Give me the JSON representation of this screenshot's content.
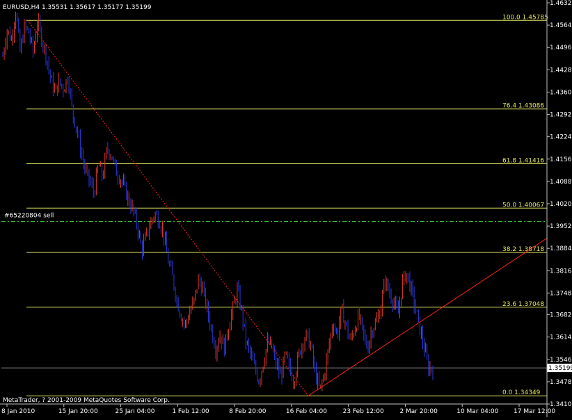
{
  "header": {
    "symbol_text": "EURUSD,H4  1.35531 1.35617 1.35177 1.35199"
  },
  "footer": {
    "copyright": "MetaTrader, ? 2001-2009 MetaQuotes Software Corp."
  },
  "colors": {
    "background": "#000000",
    "axis": "#c0c0c0",
    "text": "#ffffff",
    "fibo": "#e8e860",
    "bull_candle": "#e03a2a",
    "bear_candle": "#2a3ae0",
    "trendline": "#ff2020",
    "order_line": "#30c030",
    "bid_line": "#808080",
    "bid_box_bg": "#ffffff",
    "bid_box_text": "#000000"
  },
  "chart_data": {
    "type": "candlestick",
    "symbol": "EURUSD",
    "timeframe": "H4",
    "ohlc": {
      "open": 1.35531,
      "high": 1.35617,
      "low": 1.35177,
      "close": 1.35199
    },
    "ylim": [
      1.341,
      1.4632
    ],
    "y_ticks": [
      "1.46320",
      "1.45640",
      "1.44960",
      "1.44280",
      "1.43600",
      "1.42920",
      "1.42240",
      "1.41560",
      "1.40880",
      "1.40200",
      "1.39520",
      "1.38840",
      "1.38160",
      "1.37480",
      "1.36820",
      "1.36140",
      "1.35460",
      "1.34780",
      "1.34100"
    ],
    "x_ticks": [
      "8 Jan 2010",
      "15 Jan 20:00",
      "25 Jan 04:00",
      "1 Feb 12:00",
      "8 Feb 20:00",
      "16 Feb 04:00",
      "23 Feb 12:00",
      "2 Mar 20:00",
      "10 Mar 04:00",
      "17 Mar 12:00"
    ],
    "fibonacci": [
      {
        "label": "100.0",
        "price": "1.45785",
        "value": 1.45785
      },
      {
        "label": "76.4",
        "price": "1.43086",
        "value": 1.43086
      },
      {
        "label": "61.8",
        "price": "1.41416",
        "value": 1.41416
      },
      {
        "label": "50.0",
        "price": "1.40067",
        "value": 1.40067
      },
      {
        "label": "38.2",
        "price": "1.38718",
        "value": 1.38718
      },
      {
        "label": "23.6",
        "price": "1.37048",
        "value": 1.37048
      },
      {
        "label": "0.0",
        "price": "1.34349",
        "value": 1.34349
      }
    ],
    "order_line": {
      "label": "#65220804 sell",
      "value": 1.3966
    },
    "bid_line": {
      "label": "1.35199",
      "value": 1.35199
    },
    "price_path": [
      [
        1.447,
        1.455,
        1.452,
        1.461,
        1.448,
        1.456,
        1.454,
        1.448,
        1.4578,
        1.452
      ],
      [
        1.447,
        1.44,
        1.436,
        1.439,
        1.437,
        1.441,
        1.43,
        1.425,
        1.418,
        1.412
      ],
      [
        1.409,
        1.405,
        1.414,
        1.41,
        1.419,
        1.417,
        1.412,
        1.41,
        1.407,
        1.403
      ],
      [
        1.4,
        1.395,
        1.388,
        1.392,
        1.396,
        1.399,
        1.397,
        1.393,
        1.385,
        1.38
      ],
      [
        1.373,
        1.368,
        1.365,
        1.369,
        1.372,
        1.379,
        1.376,
        1.37,
        1.364,
        1.358
      ],
      [
        1.362,
        1.358,
        1.365,
        1.37,
        1.376,
        1.369,
        1.36,
        1.356,
        1.352,
        1.348
      ],
      [
        1.354,
        1.36,
        1.358,
        1.353,
        1.349,
        1.356,
        1.352,
        1.348,
        1.355,
        1.36
      ],
      [
        1.362,
        1.358,
        1.35,
        1.345,
        1.35,
        1.358,
        1.366,
        1.362,
        1.37,
        1.365
      ],
      [
        1.36,
        1.364,
        1.368,
        1.362,
        1.358,
        1.364,
        1.366,
        1.37,
        1.379,
        1.375
      ],
      [
        1.372,
        1.368,
        1.378,
        1.381,
        1.376,
        1.37,
        1.364,
        1.358,
        1.352,
        1.352
      ]
    ]
  }
}
